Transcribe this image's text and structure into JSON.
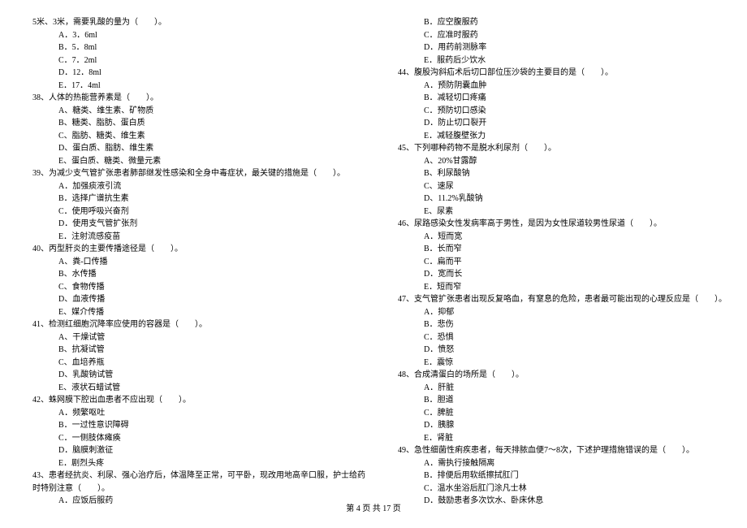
{
  "left_column": [
    {
      "indent": 0,
      "text": "5米、3米，需要乳酸的量为（　　）。"
    },
    {
      "indent": 1,
      "text": "A．3．6ml"
    },
    {
      "indent": 1,
      "text": "B．5．8ml"
    },
    {
      "indent": 1,
      "text": "C．7．2ml"
    },
    {
      "indent": 1,
      "text": "D．12．8ml"
    },
    {
      "indent": 1,
      "text": "E．17．4ml"
    },
    {
      "indent": 0,
      "text": "38、人体的热能营养素是（　　）。"
    },
    {
      "indent": 1,
      "text": "A、糖类、维生素、矿物质"
    },
    {
      "indent": 1,
      "text": "B、糖类、脂肪、蛋白质"
    },
    {
      "indent": 1,
      "text": "C、脂肪、糖类、维生素"
    },
    {
      "indent": 1,
      "text": "D、蛋白质、脂肪、维生素"
    },
    {
      "indent": 1,
      "text": "E、蛋白质、糖类、微量元素"
    },
    {
      "indent": 0,
      "text": "39、为减少支气管扩张患者肺部继发性感染和全身中毒症状，最关键的措施是（　　）。"
    },
    {
      "indent": 1,
      "text": "A．加强痰液引流"
    },
    {
      "indent": 1,
      "text": "B．选择广谱抗生素"
    },
    {
      "indent": 1,
      "text": "C．使用呼吸兴奋剂"
    },
    {
      "indent": 1,
      "text": "D．使用支气管扩张剂"
    },
    {
      "indent": 1,
      "text": "E．注射流感疫苗"
    },
    {
      "indent": 0,
      "text": "40、丙型肝炎的主要传播途径是（　　）。"
    },
    {
      "indent": 1,
      "text": "A、粪-口传播"
    },
    {
      "indent": 1,
      "text": "B、水传播"
    },
    {
      "indent": 1,
      "text": "C、食物传播"
    },
    {
      "indent": 1,
      "text": "D、血液传播"
    },
    {
      "indent": 1,
      "text": "E、媒介传播"
    },
    {
      "indent": 0,
      "text": "41、检测红细胞沉降率应使用的容器是（　　）。"
    },
    {
      "indent": 1,
      "text": "A、干燥试管"
    },
    {
      "indent": 1,
      "text": "B、抗凝试管"
    },
    {
      "indent": 1,
      "text": "C、血培养瓶"
    },
    {
      "indent": 1,
      "text": "D、乳酸钠试管"
    },
    {
      "indent": 1,
      "text": "E、液状石蜡试管"
    },
    {
      "indent": 0,
      "text": "42、蛛网膜下腔出血患者不应出现（　　）。"
    },
    {
      "indent": 1,
      "text": "A．频繁呕吐"
    },
    {
      "indent": 1,
      "text": "B．一过性意识障碍"
    },
    {
      "indent": 1,
      "text": "C．一侧肢体瘫痪"
    },
    {
      "indent": 1,
      "text": "D．脑膜刺激征"
    },
    {
      "indent": 1,
      "text": "E．剧烈头疼"
    },
    {
      "indent": 0,
      "text": "43、患者经抗炎、利尿、强心治疗后，体温降至正常，可平卧，现改用地高辛口服，护士给药"
    },
    {
      "indent": 0,
      "text": "时特别注意（　　）。"
    },
    {
      "indent": 1,
      "text": "A．应饭后服药"
    }
  ],
  "right_column": [
    {
      "indent": 1,
      "text": "B．应空腹服药"
    },
    {
      "indent": 1,
      "text": "C．应准时服药"
    },
    {
      "indent": 1,
      "text": "D．用药前测脉率"
    },
    {
      "indent": 1,
      "text": "E．服药后少饮水"
    },
    {
      "indent": 0,
      "text": "44、腹股沟斜疝术后切口部位压沙袋的主要目的是（　　）。"
    },
    {
      "indent": 1,
      "text": "A．预防阴囊血肿"
    },
    {
      "indent": 1,
      "text": "B．减轻切口疼痛"
    },
    {
      "indent": 1,
      "text": "C．预防切口感染"
    },
    {
      "indent": 1,
      "text": "D．防止切口裂开"
    },
    {
      "indent": 1,
      "text": "E．减轻腹壁张力"
    },
    {
      "indent": 0,
      "text": "45、下列哪种药物不是脱水利尿剂（　　）。"
    },
    {
      "indent": 1,
      "text": "A、20%甘露醇"
    },
    {
      "indent": 1,
      "text": "B、利尿酸钠"
    },
    {
      "indent": 1,
      "text": "C、速尿"
    },
    {
      "indent": 1,
      "text": "D、11.2%乳酸钠"
    },
    {
      "indent": 1,
      "text": "E、尿素"
    },
    {
      "indent": 0,
      "text": "46、尿路感染女性发病率高于男性，是因为女性尿道较男性尿道（　　）。"
    },
    {
      "indent": 1,
      "text": "A．短而宽"
    },
    {
      "indent": 1,
      "text": "B．长而窄"
    },
    {
      "indent": 1,
      "text": "C．扁而平"
    },
    {
      "indent": 1,
      "text": "D．宽而长"
    },
    {
      "indent": 1,
      "text": "E．短而窄"
    },
    {
      "indent": 0,
      "text": "47、支气管扩张患者出现反复咯血，有窒息的危险，患者最可能出现的心理反应是（　　）。"
    },
    {
      "indent": 1,
      "text": "A．抑郁"
    },
    {
      "indent": 1,
      "text": "B．悲伤"
    },
    {
      "indent": 1,
      "text": "C．恐惧"
    },
    {
      "indent": 1,
      "text": "D．愤怒"
    },
    {
      "indent": 1,
      "text": "E．震惊"
    },
    {
      "indent": 0,
      "text": "48、合成清蛋白的场所是（　　）。"
    },
    {
      "indent": 1,
      "text": "A．肝脏"
    },
    {
      "indent": 1,
      "text": "B．胆道"
    },
    {
      "indent": 1,
      "text": "C．脾脏"
    },
    {
      "indent": 1,
      "text": "D．胰腺"
    },
    {
      "indent": 1,
      "text": "E．肾脏"
    },
    {
      "indent": 0,
      "text": "49、急性细菌性痢疾患者，每天排脓血便7～8次，下述护理措施错误的是（　　）。"
    },
    {
      "indent": 1,
      "text": "A．需执行接触隔离"
    },
    {
      "indent": 1,
      "text": "B．排便后用软纸擦拭肛门"
    },
    {
      "indent": 1,
      "text": "C．温水坐浴后肛门涂凡士林"
    },
    {
      "indent": 1,
      "text": "D．鼓励患者多次饮水、卧床休息"
    }
  ],
  "footer": "第 4 页 共 17 页"
}
